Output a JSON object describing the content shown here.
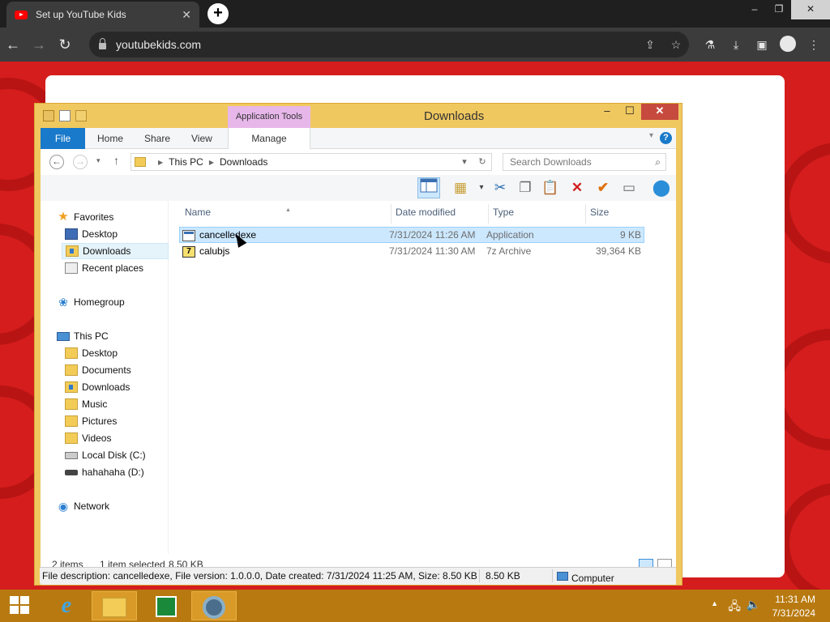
{
  "browser": {
    "tab_title": "Set up YouTube Kids",
    "tab_close": "✕",
    "new_tab": "+",
    "url": "youtubekids.com",
    "controls": {
      "minimize": "–",
      "restore": "❐",
      "close": "✕"
    }
  },
  "explorer": {
    "window_title": "Downloads",
    "contextual_tab": "Application Tools",
    "ribbon_tabs": [
      "File",
      "Home",
      "Share",
      "View",
      "Manage"
    ],
    "controls": {
      "minimize": "–",
      "maximize": "☐",
      "close": "✕"
    },
    "address": {
      "segments": [
        "This PC",
        "Downloads"
      ]
    },
    "search_placeholder": "Search Downloads",
    "nav": {
      "favorites": "Favorites",
      "fav_items": [
        "Desktop",
        "Downloads",
        "Recent places"
      ],
      "homegroup": "Homegroup",
      "this_pc": "This PC",
      "pc_items": [
        "Desktop",
        "Documents",
        "Downloads",
        "Music",
        "Pictures",
        "Videos",
        "Local Disk (C:)",
        "hahahaha (D:)"
      ],
      "network": "Network"
    },
    "columns": [
      "Name",
      "Date modified",
      "Type",
      "Size"
    ],
    "files": [
      {
        "name": "cancelledexe",
        "date": "7/31/2024 11:26 AM",
        "type": "Application",
        "size": "9 KB",
        "icon": "exe-icon"
      },
      {
        "name": "calubjs",
        "date": "7/31/2024 11:30 AM",
        "type": "7z Archive",
        "size": "39,364 KB",
        "icon": "7z-icon"
      }
    ],
    "status": {
      "items": "2 items",
      "selected": "1 item selected",
      "sel_size": "8.50 KB"
    },
    "infobar": {
      "description": "File description: cancelledexe, File version: 1.0.0.0, Date created: 7/31/2024 11:25 AM, Size: 8.50 KB",
      "size": "8.50 KB",
      "location": "Computer"
    }
  },
  "taskbar": {
    "time": "11:31 AM",
    "date": "7/31/2024"
  },
  "colors": {
    "taskbar": "#b87a10",
    "explorer_frame": "#f0c860",
    "file_tab": "#1979ca",
    "page_bg": "#d51d1d"
  }
}
